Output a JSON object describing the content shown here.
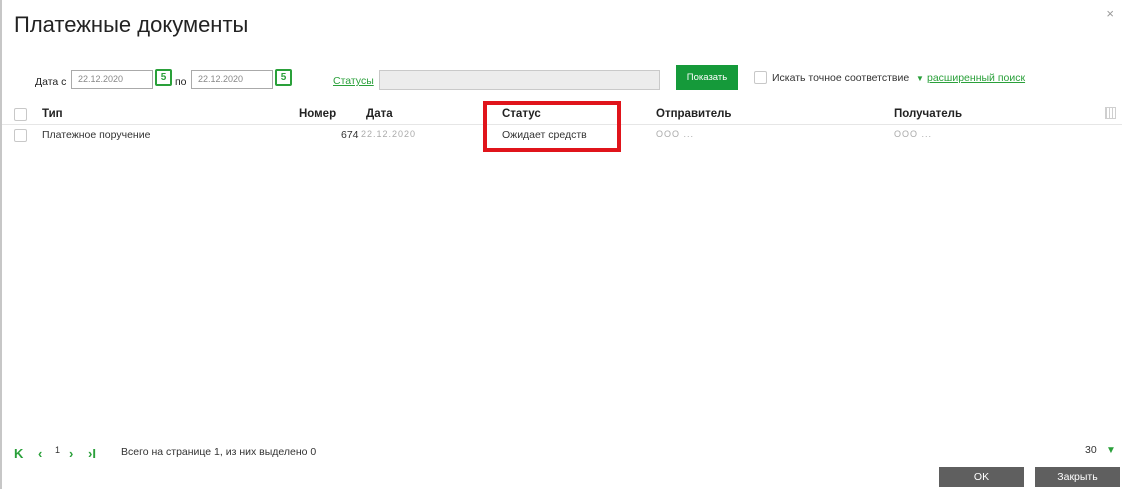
{
  "dialog": {
    "title": "Платежные документы",
    "close_icon": "close-icon"
  },
  "filter": {
    "date_from_label": "Дата с",
    "date_from_value": "22.12.2020",
    "date_to_label": "по",
    "date_to_value": "22.12.2020",
    "calendar_icon": "calendar-icon",
    "statuses_link": "Статусы",
    "statuses_value": "",
    "show_button": "Показать",
    "exact_match_label": "Искать точное соответствие",
    "advanced_search_link": "расширенный поиск"
  },
  "table": {
    "columns": [
      "Тип",
      "Номер",
      "Дата",
      "Статус",
      "Отправитель",
      "Получатель"
    ],
    "rows": [
      {
        "type": "Платежное поручение",
        "number": "674",
        "date": "22.12.2020",
        "status": "Ожидает средств",
        "sender": "ООО ...",
        "recipient": "ООО ..."
      }
    ]
  },
  "footer": {
    "page_number": "1",
    "summary": "Всего на странице 1, из них выделено 0",
    "per_page": "30",
    "ok_button": "OK",
    "close_button": "Закрыть"
  },
  "colors": {
    "accent": "#2aa03a",
    "show_button": "#159a3a",
    "highlight": "#e0141b",
    "footer_button": "#5f5f5f"
  }
}
